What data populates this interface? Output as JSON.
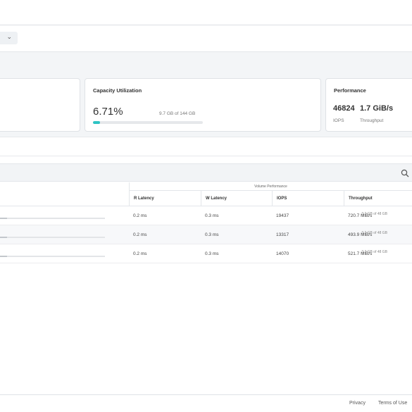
{
  "filters": {
    "dropdown_icon": "chevron-down-icon"
  },
  "cards": {
    "capacity": {
      "title": "Capacity Utilization",
      "percent": "6.71%",
      "detail": "9.7 GB of 144 GB",
      "fraction": 0.0671,
      "bar_color": "#2ec4c4"
    },
    "performance": {
      "title": "Performance",
      "iops_value": "46824",
      "throughput_value": "1.7 GiB/s",
      "iops_label": "IOPS",
      "throughput_label": "Throughput"
    }
  },
  "table": {
    "group_header": "Volume Performance",
    "columns": [
      "R Latency",
      "W Latency",
      "IOPS",
      "Throughput"
    ],
    "rows": [
      {
        "capacity": "3.2 GB of 48 GB",
        "capacity_fraction": 0.0667,
        "r_latency": "0.2 ms",
        "w_latency": "0.3 ms",
        "iops": "19437",
        "throughput": "720.7 MiB/s"
      },
      {
        "capacity": "3.2 GB of 48 GB",
        "capacity_fraction": 0.0667,
        "r_latency": "0.2 ms",
        "w_latency": "0.3 ms",
        "iops": "13317",
        "throughput": "493.9 MiB/s"
      },
      {
        "capacity": "3.2 GB of 48 GB",
        "capacity_fraction": 0.0667,
        "r_latency": "0.2 ms",
        "w_latency": "0.3 ms",
        "iops": "14070",
        "throughput": "521.7 MiB/s"
      }
    ]
  },
  "footer": {
    "privacy": "Privacy",
    "terms": "Terms of Use"
  }
}
